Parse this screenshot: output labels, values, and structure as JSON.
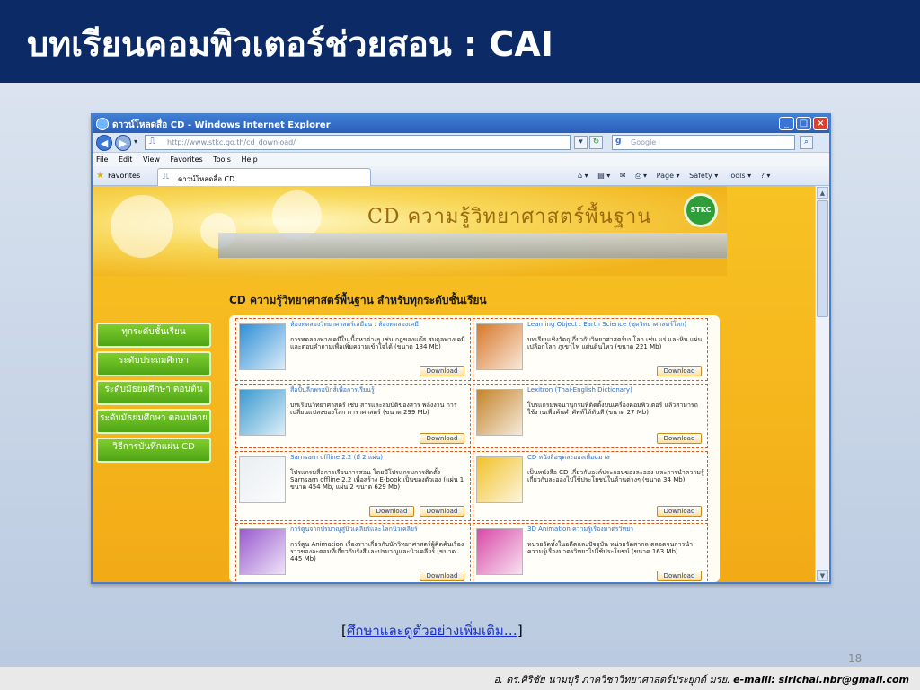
{
  "slide": {
    "title": "บทเรียนคอมพิวเตอร์ช่วยสอน : CAI",
    "more_link_open": "[",
    "more_link_text": "ศึกษาและดูตัวอย่างเพิ่มเติม…",
    "more_link_close": "]",
    "page_number": "18",
    "footer_author": "อ. ดร.ศิริชัย นามบุรี  ภาควิชาวิทยาศาสตร์ประยุกต์  มรย.",
    "footer_email": "e-malil: sirichai.nbr@gmail.com"
  },
  "browser": {
    "window_title": "ดาวน์โหลดสื่อ CD - Windows Internet Explorer",
    "url": "http://www.stkc.go.th/cd_download/",
    "search_placeholder": "Google",
    "menu": [
      "File",
      "Edit",
      "View",
      "Favorites",
      "Tools",
      "Help"
    ],
    "favorites_label": "Favorites",
    "tab_label": "ดาวน์โหลดสื่อ CD",
    "toolbar": [
      "Page ▾",
      "Safety ▾",
      "Tools ▾"
    ]
  },
  "site": {
    "banner_title": "CD ความรู้วิทยาศาสตร์พื้นฐาน",
    "logo_text": "STKC",
    "section_heading": "CD ความรู้วิทยาศาสตร์พื้นฐาน สำหรับทุกระดับชั้นเรียน",
    "sidebar": [
      {
        "label": "ทุกระดับชั้นเรียน"
      },
      {
        "label": "ระดับประถมศึกษา"
      },
      {
        "label": "ระดับมัธยมศึกษา ตอนต้น"
      },
      {
        "label": "ระดับมัธยมศึกษา ตอนปลาย"
      },
      {
        "label": "วิธีการบันทึกแผ่น CD"
      }
    ],
    "download_label": "Download",
    "cards": [
      {
        "title": "ห้องทดลองวิทยาศาสตร์เสมือน : ห้องทดลองเคมี",
        "desc": "การทดลองทางเคมีในเนื้อหาต่างๆ เช่น กฎของแก๊ส สมดุลทางเคมี และตอบคำถามเพื่อเพิ่มความเข้าใจได้ (ขนาด 184 Mb)",
        "color": "#2f8fd6"
      },
      {
        "title": "Learning Object : Earth Science (ชุดวิทยาศาสตร์โลก)",
        "desc": "บทเรียนเชิงวัตถุเกี่ยวกับวิทยาศาสตร์บนโลก เช่น แร่ และหิน แผ่นเปลือกโลก ภูเขาไฟ แผ่นดินไหว (ขนาด 221 Mb)",
        "color": "#d8782a"
      },
      {
        "title": "สื่อปั้นลีกพรอบิกส์เพื่อการเรียนรู้",
        "desc": "บทเรียนวิทยาศาสตร์ เช่น สารและสมบัติของสาร พลังงาน การเปลี่ยนแปลงของโลก ดาราศาสตร์ (ขนาด 299 Mb)",
        "color": "#3a9ad0"
      },
      {
        "title": "Lexitron (Thai-English Dictionary)",
        "desc": "โปรแกรมพจนานุกรมที่ติดตั้งบนเครื่องคอมพิวเตอร์ แล้วสามารถใช้งานเพื่อค้นคำศัพท์ได้ทันที (ขนาด 27 Mb)",
        "color": "#c4842a"
      },
      {
        "title": "Sarnsarn offline 2.2 (มี 2 แผ่น)",
        "desc": "โปรแกรมสื่อการเรียนการสอน โดยมีโปรแกรมการติดตั้ง Sarnsarn offline 2.2 เพื่อสร้าง E-book เป็นของตัวเอง (แผ่น 1 ขนาด 454 Mb, แผ่น 2 ขนาด 629 Mb)",
        "color": "#e9eef2"
      },
      {
        "title": "CD หนังสือชุดละอองเพื่อฉมาล",
        "desc": "เป็นหนังสือ CD เกี่ยวกับองค์ประกอบของละออง และการนำความรู้เกี่ยวกับละอองไปใช้ประโยชน์ในด้านต่างๆ (ขนาด 34 Mb)",
        "color": "#f1c22a"
      },
      {
        "title": "การ์ตูนจากปรมาณูสู่นิวเคลียร์และโลกนิวเคลียร์",
        "desc": "การ์ตูน Animation เรื่องราวเกี่ยวกับนักวิทยาศาสตร์ผู้คิดค้นเรื่องราวของอะตอมที่เกี่ยวกับรังสีและปรมาณูและนิวเคลียร์ (ขนาด 445 Mb)",
        "color": "#9a5ad0"
      },
      {
        "title": "3D Animation ความรู้เรื่องมาตรวิทยา",
        "desc": "หน่วยวัดทั้งในอดีตและปัจจุบัน หน่วยวัดสากล ตลอดจนการนำความรู้เรื่องมาตรวิทยาไปใช้ประโยชน์ (ขนาด 163 Mb)",
        "color": "#d84aa8"
      }
    ]
  }
}
